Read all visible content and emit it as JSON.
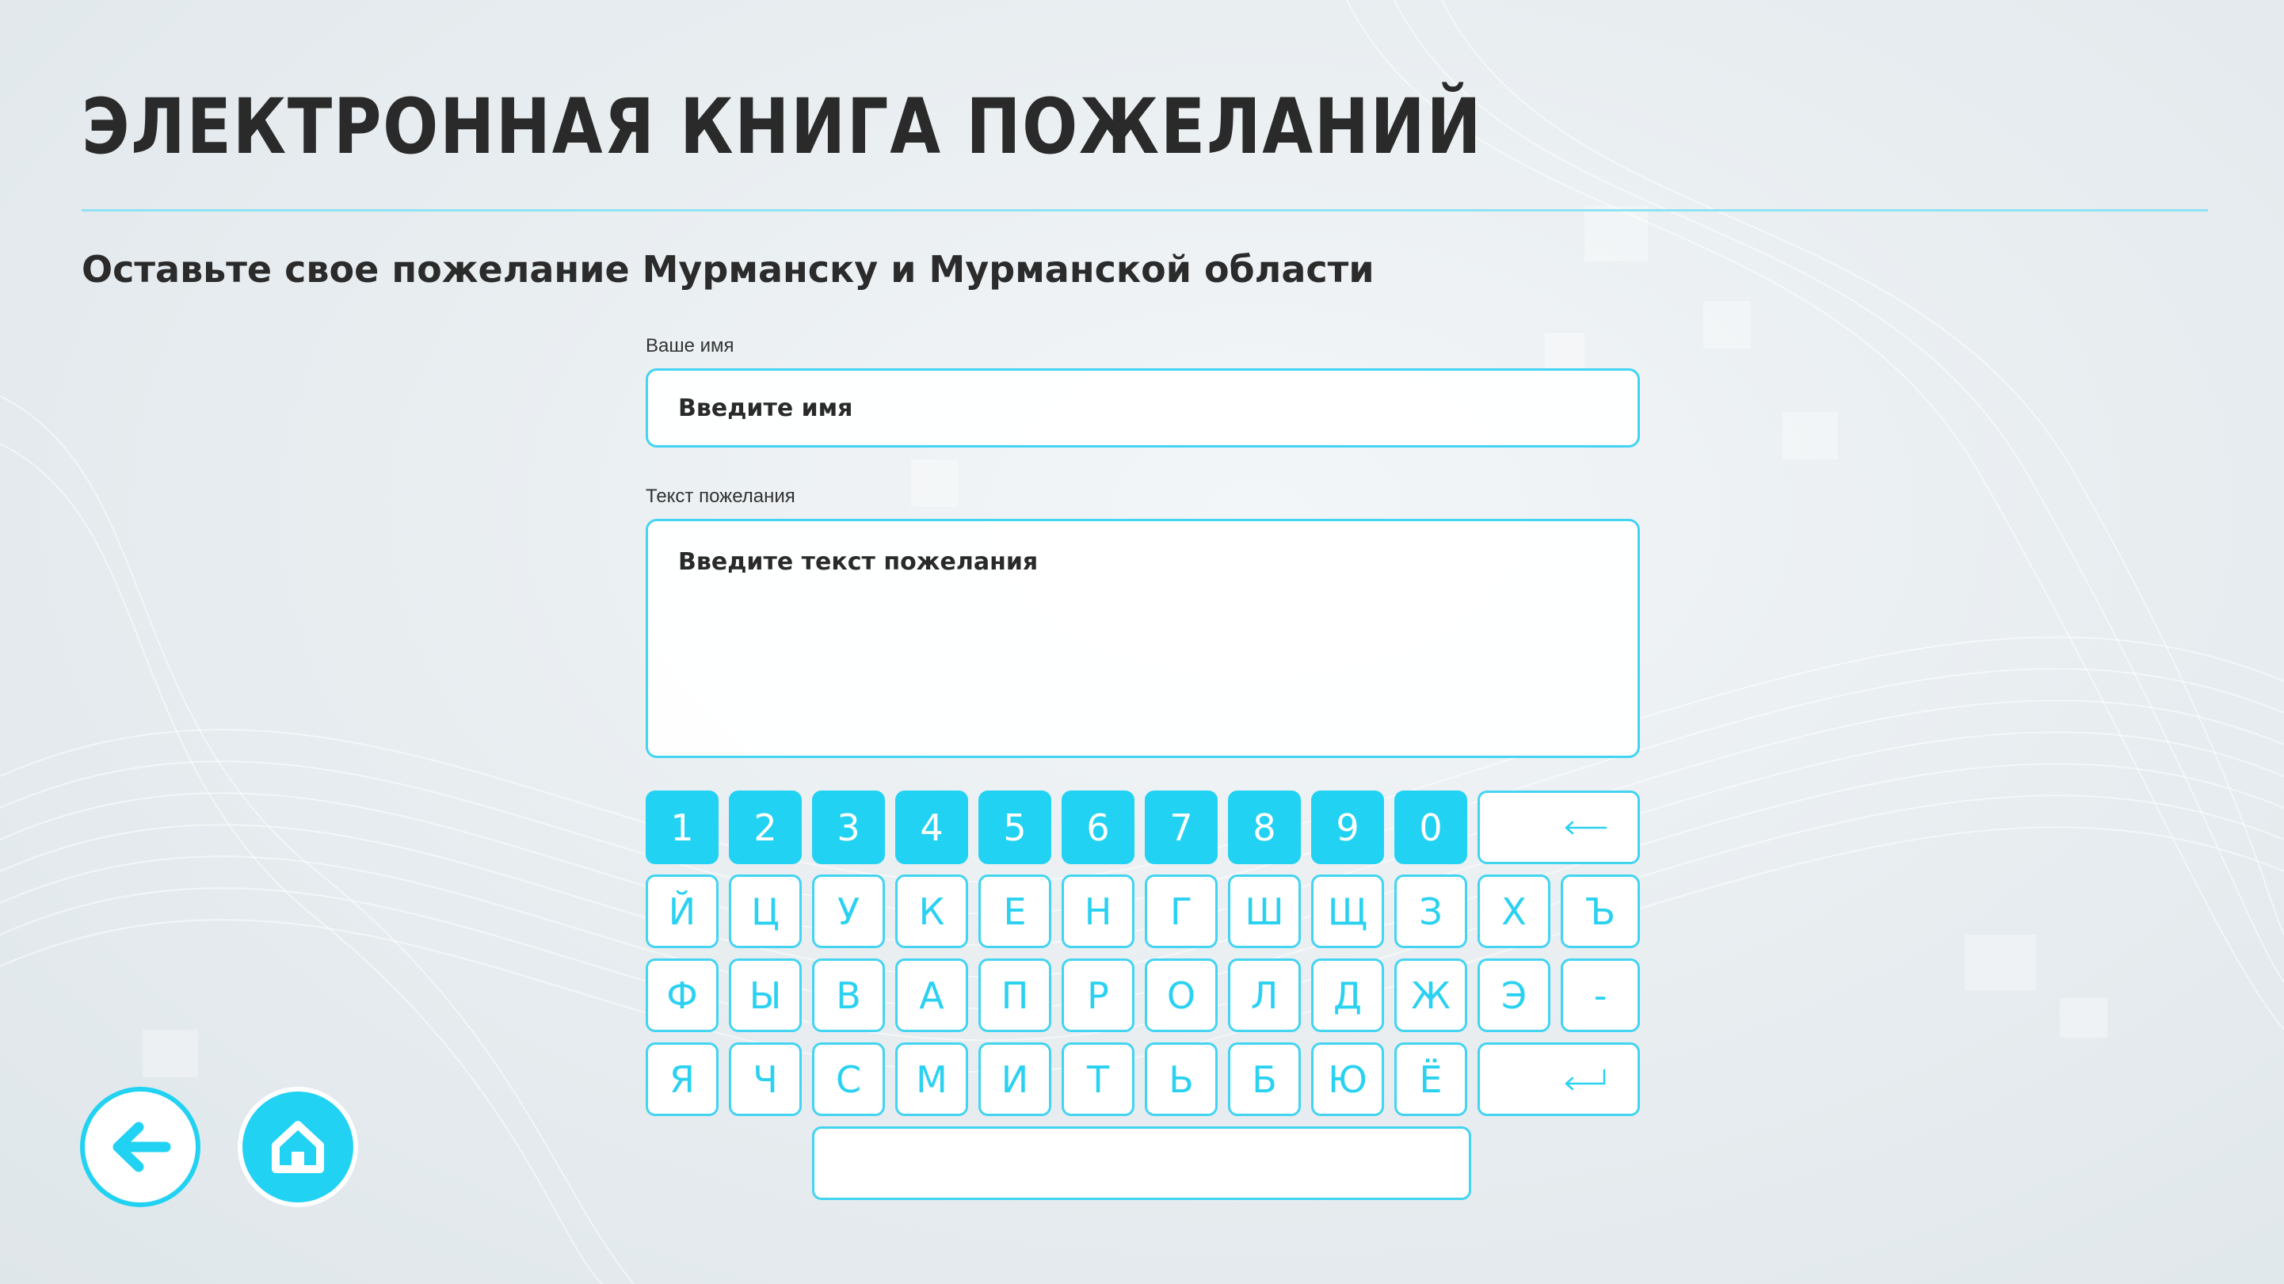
{
  "header": {
    "title": "Электронная книга пожеланий",
    "subtitle": "Оставьте свое пожелание Мурманску и Мурманской области"
  },
  "form": {
    "name_label": "Ваше имя",
    "name_placeholder": "Введите имя",
    "wish_label": "Текст пожелания",
    "wish_placeholder": "Введите текст пожелания"
  },
  "keyboard": {
    "rows": [
      [
        "1",
        "2",
        "3",
        "4",
        "5",
        "6",
        "7",
        "8",
        "9",
        "0"
      ],
      [
        "Й",
        "Ц",
        "У",
        "К",
        "Е",
        "Н",
        "Г",
        "Ш",
        "Щ",
        "З",
        "Х",
        "Ъ"
      ],
      [
        "Ф",
        "Ы",
        "В",
        "А",
        "П",
        "Р",
        "О",
        "Л",
        "Д",
        "Ж",
        "Э",
        "-"
      ],
      [
        "Я",
        "Ч",
        "С",
        "М",
        "И",
        "Т",
        "Ь",
        "Б",
        "Ю",
        "Ё"
      ]
    ],
    "special_keys": [
      "backspace",
      "enter",
      "space"
    ]
  },
  "navigation": {
    "back_icon": "arrow-left-icon",
    "home_icon": "home-icon"
  },
  "colors": {
    "accent": "#22d2f2",
    "key_border": "#43d4f2",
    "text": "#2a2a2a",
    "divider": "#8fe3f3"
  }
}
